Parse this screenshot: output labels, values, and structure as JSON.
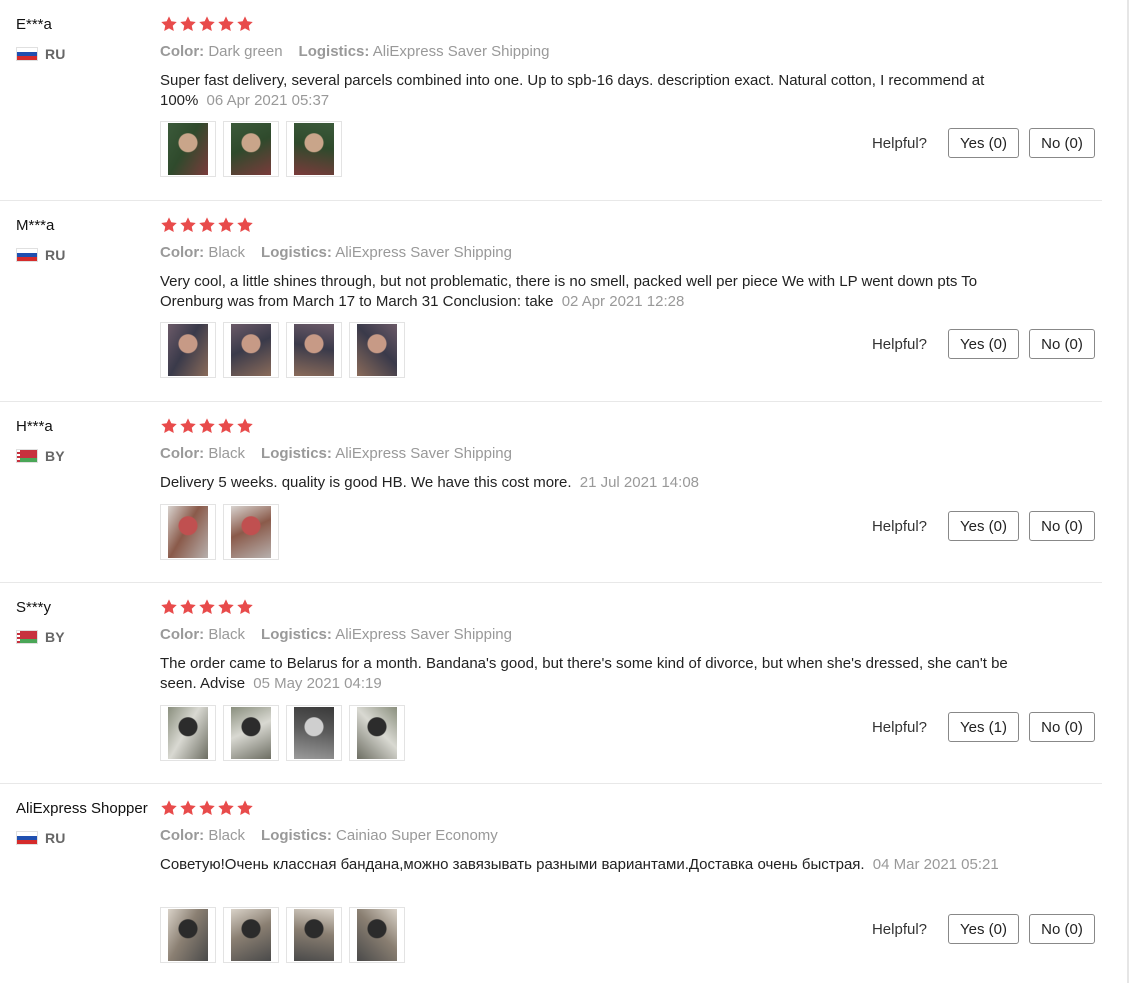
{
  "colors": {
    "star": "#e84b4b",
    "meta_label": "#999999",
    "divider": "#e8e8e8"
  },
  "labels": {
    "color": "Color:",
    "logistics": "Logistics:",
    "helpful": "Helpful?"
  },
  "reviews": [
    {
      "user": "E***a",
      "country": "RU",
      "rating": 5,
      "color_value": "Dark green",
      "logistics_value": "AliExpress Saver Shipping",
      "text": "Super fast delivery, several parcels combined into one. Up to spb-16 days. description exact. Natural cotton, I recommend at 100%",
      "date": "06 Apr 2021 05:37",
      "photos": [
        "photo-person-green-bandana",
        "photo-person-green-bandana",
        "photo-person-green-bandana"
      ],
      "yes": "Yes (0)",
      "no": "No (0)"
    },
    {
      "user": "M***a",
      "country": "RU",
      "rating": 5,
      "color_value": "Black",
      "logistics_value": "AliExpress Saver Shipping",
      "text": "Very cool, a little shines through, but not problematic, there is no smell, packed well per piece We with LP went down pts To Orenburg was from March 17 to March 31 Conclusion: take",
      "date": "02 Apr 2021 12:28",
      "photos": [
        "photo-selfie",
        "photo-selfie",
        "photo-selfie",
        "photo-selfie"
      ],
      "yes": "Yes (0)",
      "no": "No (0)"
    },
    {
      "user": "H***a",
      "country": "BY",
      "rating": 5,
      "color_value": "Black",
      "logistics_value": "AliExpress Saver Shipping",
      "text": "Delivery 5 weeks. quality is good HB. We have this cost more.",
      "date": "21 Jul 2021 14:08",
      "photos": [
        "photo-mirror-selfie",
        "photo-mirror-selfie"
      ],
      "yes": "Yes (0)",
      "no": "No (0)"
    },
    {
      "user": "S***y",
      "country": "BY",
      "rating": 5,
      "color_value": "Black",
      "logistics_value": "AliExpress Saver Shipping",
      "text": "The order came to Belarus for a month. Bandana's good, but there's some kind of divorce, but when she's dressed, she can't be seen. Advise",
      "date": "05 May 2021 04:19",
      "photos": [
        "photo-bandana-flat",
        "photo-bandana-flat",
        "photo-bandana-folded",
        "photo-bandana-flat"
      ],
      "yes": "Yes (1)",
      "no": "No (0)"
    },
    {
      "user": "AliExpress Shopper",
      "country": "RU",
      "rating": 5,
      "color_value": "Black",
      "logistics_value": "Cainiao Super Economy",
      "text": "Советую!Очень классная бандана,можно завязывать разными вариантами.Доставка очень быстрая.",
      "date": "04 Mar 2021 05:21",
      "photos": [
        "photo-bandana-dark",
        "photo-bandana-dark",
        "photo-bandana-dark",
        "photo-bandana-dark"
      ],
      "yes": "Yes (0)",
      "no": "No (0)"
    }
  ]
}
